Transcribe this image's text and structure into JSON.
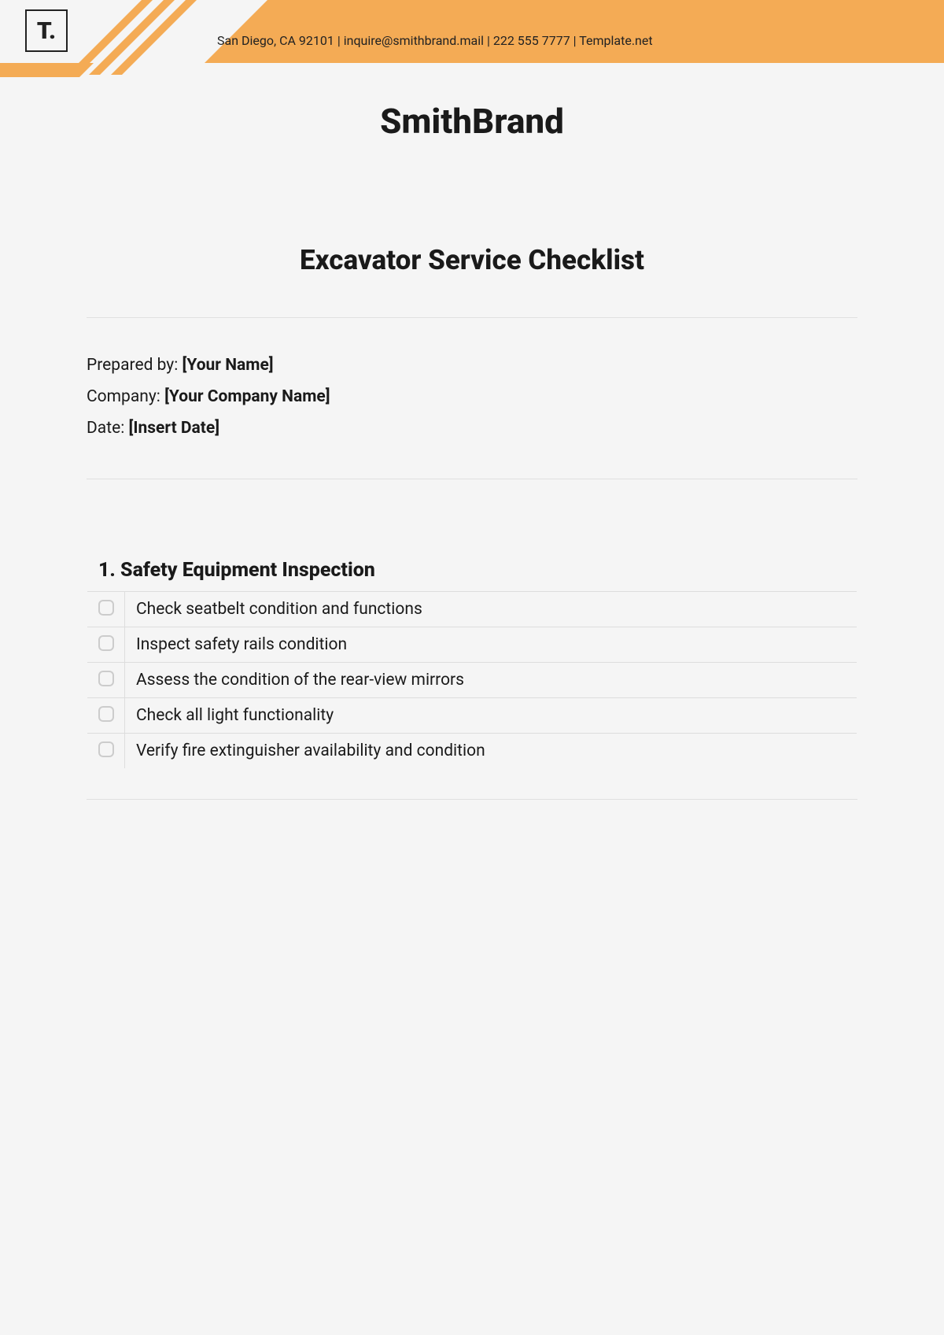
{
  "header": {
    "contact_line": "San Diego, CA 92101 | inquire@smithbrand.mail | 222 555 7777 | Template.net",
    "logo_text": "T.",
    "brand_title": "SmithBrand"
  },
  "document": {
    "title": "Excavator Service Checklist"
  },
  "meta": {
    "prepared_label": "Prepared by: ",
    "prepared_value": "[Your Name]",
    "company_label": "Company: ",
    "company_value": "[Your Company Name]",
    "date_label": "Date: ",
    "date_value": "[Insert Date]"
  },
  "section": {
    "title": "1. Safety Equipment Inspection",
    "items": [
      "Check seatbelt condition and functions",
      "Inspect safety rails condition",
      "Assess the condition of the rear-view mirrors",
      "Check all light functionality",
      "Verify fire extinguisher availability and condition"
    ]
  }
}
